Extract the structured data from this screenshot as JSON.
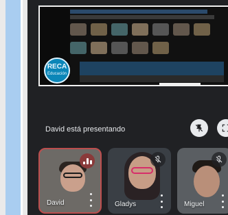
{
  "presenting_banner": {
    "text": "David está presentando"
  },
  "presentation": {
    "logo_text_line1": "RECA",
    "logo_text_line2": "Educación"
  },
  "participants": [
    {
      "name": "David",
      "status": "speaking"
    },
    {
      "name": "Gladys",
      "status": "muted"
    },
    {
      "name": "Miguel",
      "status": "muted"
    }
  ],
  "icons": {
    "unpin": "unpin-icon",
    "fullscreen": "fullscreen-icon",
    "more": "more-options-icon",
    "mic_off": "mic-off-icon",
    "speaking": "speaking-indicator-icon"
  }
}
